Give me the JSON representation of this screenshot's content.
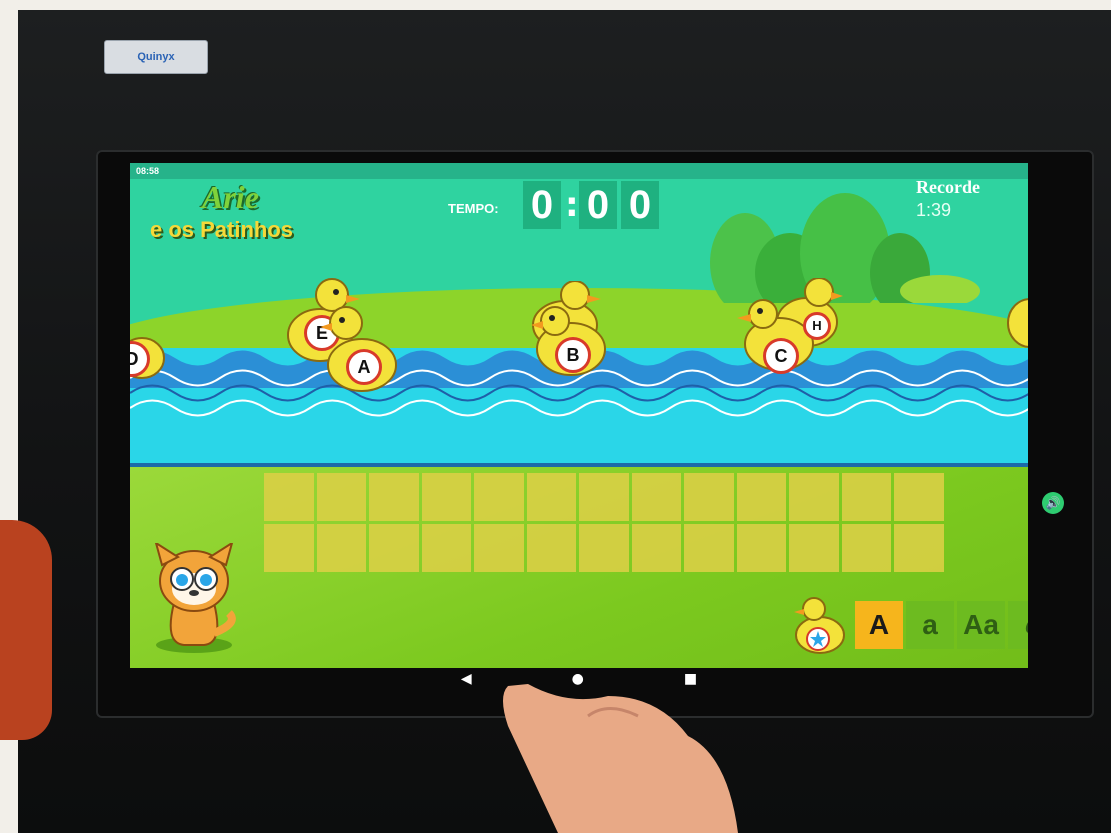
{
  "device": {
    "sticker_label": "Quinyx"
  },
  "status_bar": {
    "time": "08:58"
  },
  "game": {
    "logo_line1": "Arie",
    "logo_line2": "e os Patinhos",
    "timer_label": "TEMPO:",
    "timer_digits": [
      "0",
      "0",
      "0"
    ],
    "record_label": "Recorde",
    "record_value": "1:39"
  },
  "ducks": [
    {
      "letter": "D"
    },
    {
      "letter": "E"
    },
    {
      "letter": "A"
    },
    {
      "letter": "B"
    },
    {
      "letter": "C"
    },
    {
      "letter": "H"
    }
  ],
  "case_options": [
    {
      "label": "A",
      "active": true
    },
    {
      "label": "a",
      "active": false
    },
    {
      "label": "Aa",
      "active": false
    },
    {
      "label": "a",
      "active": false
    }
  ],
  "nav": {
    "back": "◀",
    "home": "●",
    "recents": "■"
  },
  "colors": {
    "sky": "#2fd3a0",
    "water": "#2ad6e8",
    "grass": "#7cc91f",
    "timer_bg": "#1fb180",
    "active_case": "#f6b51c"
  }
}
